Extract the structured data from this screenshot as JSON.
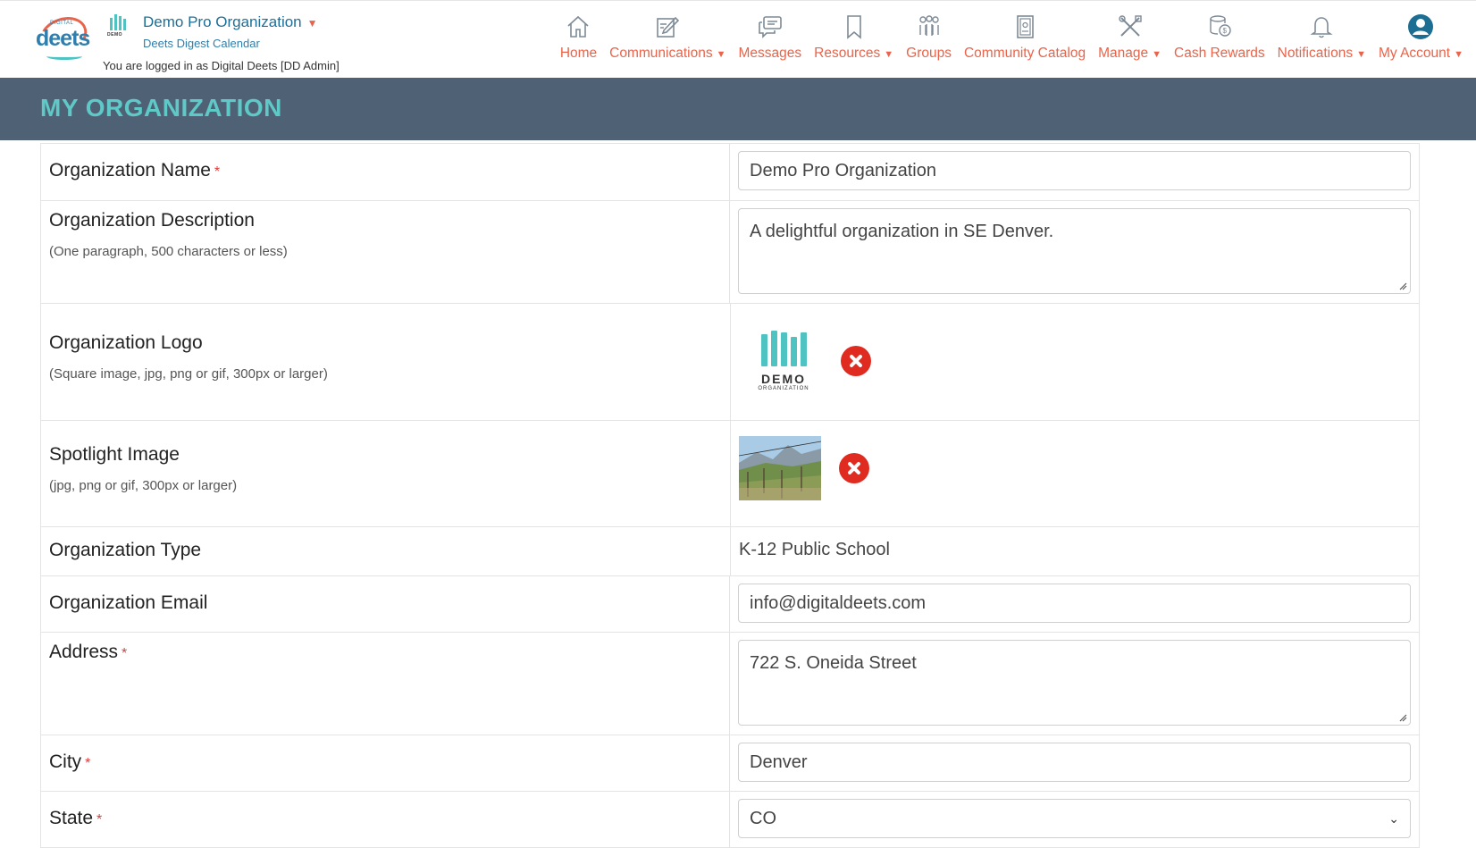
{
  "header": {
    "brand": {
      "word": "deets",
      "small": "DIGITAL"
    },
    "org_mini_label": "DEMO",
    "org_name": "Demo Pro Organization",
    "org_caret": "▼",
    "org_sub": "Deets Digest Calendar",
    "logged_in": "You are logged in as Digital Deets [DD Admin]"
  },
  "nav": [
    {
      "label": "Home",
      "icon": "home-icon",
      "dropdown": false
    },
    {
      "label": "Communications",
      "icon": "compose-icon",
      "dropdown": true
    },
    {
      "label": "Messages",
      "icon": "messages-icon",
      "dropdown": false
    },
    {
      "label": "Resources",
      "icon": "bookmark-icon",
      "dropdown": true
    },
    {
      "label": "Groups",
      "icon": "groups-icon",
      "dropdown": false
    },
    {
      "label": "Community Catalog",
      "icon": "catalog-icon",
      "dropdown": false
    },
    {
      "label": "Manage",
      "icon": "tools-icon",
      "dropdown": true
    },
    {
      "label": "Cash Rewards",
      "icon": "cash-icon",
      "dropdown": false
    },
    {
      "label": "Notifications",
      "icon": "bell-icon",
      "dropdown": true
    },
    {
      "label": "My Account",
      "icon": "account-icon",
      "dropdown": true
    }
  ],
  "page_title": "MY ORGANIZATION",
  "form": {
    "org_name": {
      "label": "Organization Name",
      "required": "*",
      "value": "Demo Pro Organization"
    },
    "org_desc": {
      "label": "Organization Description",
      "hint": "(One paragraph, 500 characters or less)",
      "value": "A delightful organization in SE Denver."
    },
    "org_logo": {
      "label": "Organization Logo",
      "hint": "(Square image, jpg, png or gif, 300px or larger)",
      "logo_word": "DEMO",
      "logo_sub": "ORGANIZATION"
    },
    "spotlight": {
      "label": "Spotlight Image",
      "hint": "(jpg, png or gif, 300px or larger)"
    },
    "org_type": {
      "label": "Organization Type",
      "value": "K-12 Public School"
    },
    "org_email": {
      "label": "Organization Email",
      "value": "info@digitaldeets.com"
    },
    "address": {
      "label": "Address",
      "required": "*",
      "value": "722 S. Oneida Street"
    },
    "city": {
      "label": "City",
      "required": "*",
      "value": "Denver"
    },
    "state": {
      "label": "State",
      "required": "*",
      "value": "CO"
    }
  },
  "colors": {
    "accent": "#e9644a",
    "link": "#1d6f98",
    "band": "#4f6275",
    "title": "#5ec9c6",
    "delete": "#e02b20"
  }
}
